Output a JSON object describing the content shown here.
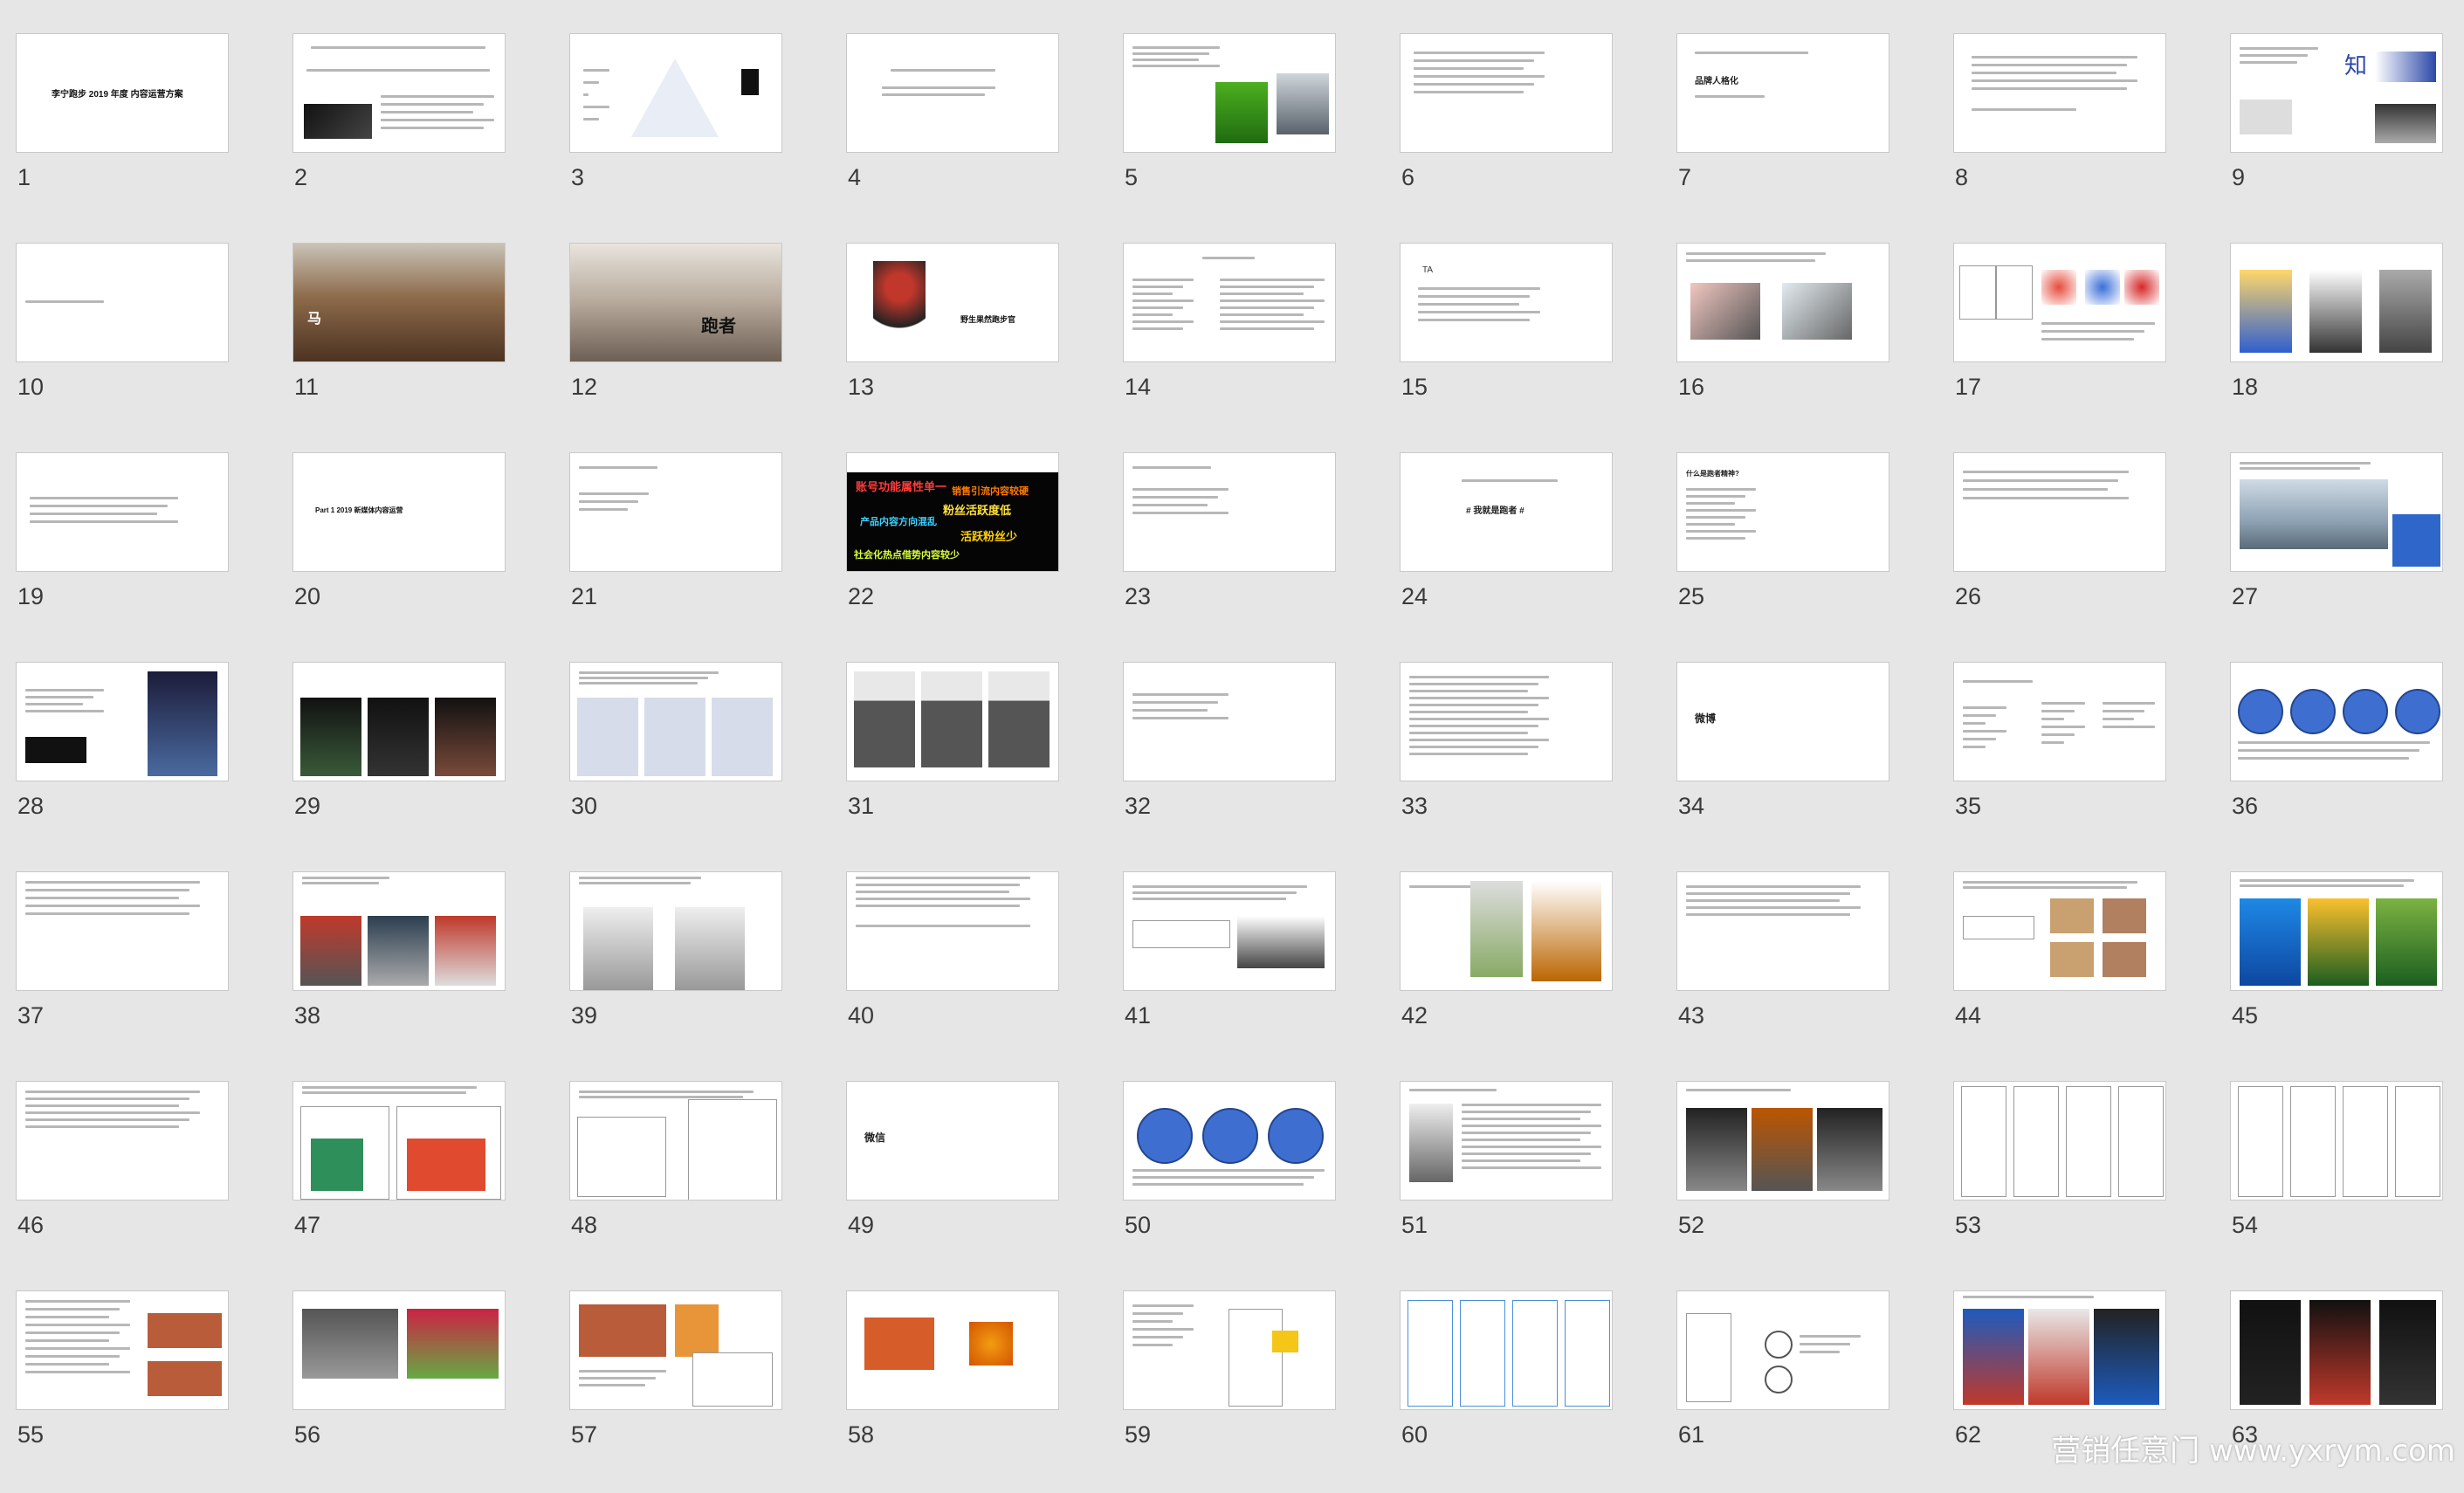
{
  "slides": [
    {
      "n": "1",
      "title": "李宁跑步 2019 年度 内容运营方案"
    },
    {
      "n": "2"
    },
    {
      "n": "3"
    },
    {
      "n": "4"
    },
    {
      "n": "5"
    },
    {
      "n": "6"
    },
    {
      "n": "7",
      "title": "品牌人格化"
    },
    {
      "n": "8"
    },
    {
      "n": "9",
      "title": "知"
    },
    {
      "n": "10"
    },
    {
      "n": "11",
      "title": "马"
    },
    {
      "n": "12",
      "title": "跑者"
    },
    {
      "n": "13",
      "title": "野生果然跑步官"
    },
    {
      "n": "14"
    },
    {
      "n": "15",
      "title": "TA"
    },
    {
      "n": "16"
    },
    {
      "n": "17"
    },
    {
      "n": "18"
    },
    {
      "n": "19"
    },
    {
      "n": "20",
      "title": "Part 1  2019 新媒体内容运营"
    },
    {
      "n": "21"
    },
    {
      "n": "22"
    },
    {
      "n": "23"
    },
    {
      "n": "24",
      "title": "# 我就是跑者 #"
    },
    {
      "n": "25",
      "title": "什么是跑者精神?"
    },
    {
      "n": "26"
    },
    {
      "n": "27"
    },
    {
      "n": "28"
    },
    {
      "n": "29"
    },
    {
      "n": "30"
    },
    {
      "n": "31"
    },
    {
      "n": "32"
    },
    {
      "n": "33"
    },
    {
      "n": "34",
      "title": "微博"
    },
    {
      "n": "35"
    },
    {
      "n": "36"
    },
    {
      "n": "37"
    },
    {
      "n": "38"
    },
    {
      "n": "39"
    },
    {
      "n": "40"
    },
    {
      "n": "41"
    },
    {
      "n": "42"
    },
    {
      "n": "43"
    },
    {
      "n": "44"
    },
    {
      "n": "45"
    },
    {
      "n": "46"
    },
    {
      "n": "47"
    },
    {
      "n": "48"
    },
    {
      "n": "49",
      "title": "微信"
    },
    {
      "n": "50"
    },
    {
      "n": "51"
    },
    {
      "n": "52"
    },
    {
      "n": "53"
    },
    {
      "n": "54"
    },
    {
      "n": "55"
    },
    {
      "n": "56"
    },
    {
      "n": "57"
    },
    {
      "n": "58"
    },
    {
      "n": "59"
    },
    {
      "n": "60"
    },
    {
      "n": "61"
    },
    {
      "n": "62"
    },
    {
      "n": "63"
    }
  ],
  "slide22_words": [
    "账号功能属性单一",
    "产品内容方向混乱",
    "粉丝活跃度低",
    "销售引流内容较硬",
    "活跃粉丝少",
    "社会化热点借势内容较少"
  ],
  "watermark": "营销任意门 www.yxrym.com"
}
